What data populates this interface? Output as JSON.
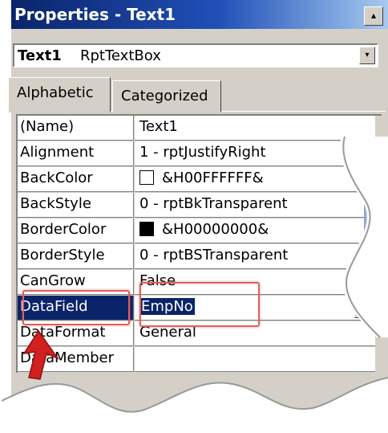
{
  "window": {
    "title": "Properties - Text1",
    "title_button_glyph": "▴"
  },
  "object_selector": {
    "name": "Text1",
    "type": "RptTextBox",
    "dropdown_glyph": "▾"
  },
  "tabs": [
    {
      "label": "Alphabetic",
      "active": true
    },
    {
      "label": "Categorized",
      "active": false
    }
  ],
  "properties": [
    {
      "name": "(Name)",
      "value": "Text1"
    },
    {
      "name": "Alignment",
      "value": "1 - rptJustifyRight"
    },
    {
      "name": "BackColor",
      "value": "&H00FFFFFF&",
      "swatch": "#ffffff"
    },
    {
      "name": "BackStyle",
      "value": "0 - rptBkTransparent"
    },
    {
      "name": "BorderColor",
      "value": "&H00000000&",
      "swatch": "#000000"
    },
    {
      "name": "BorderStyle",
      "value": "0 - rptBSTransparent"
    },
    {
      "name": "CanGrow",
      "value": "False"
    },
    {
      "name": "DataField",
      "value": "EmpNo",
      "selected": true
    },
    {
      "name": "DataFormat",
      "value": "General"
    },
    {
      "name": "DataMember",
      "value": ""
    }
  ],
  "colors": {
    "highlight": "#0a246a",
    "annotation_red": "#e06060"
  }
}
